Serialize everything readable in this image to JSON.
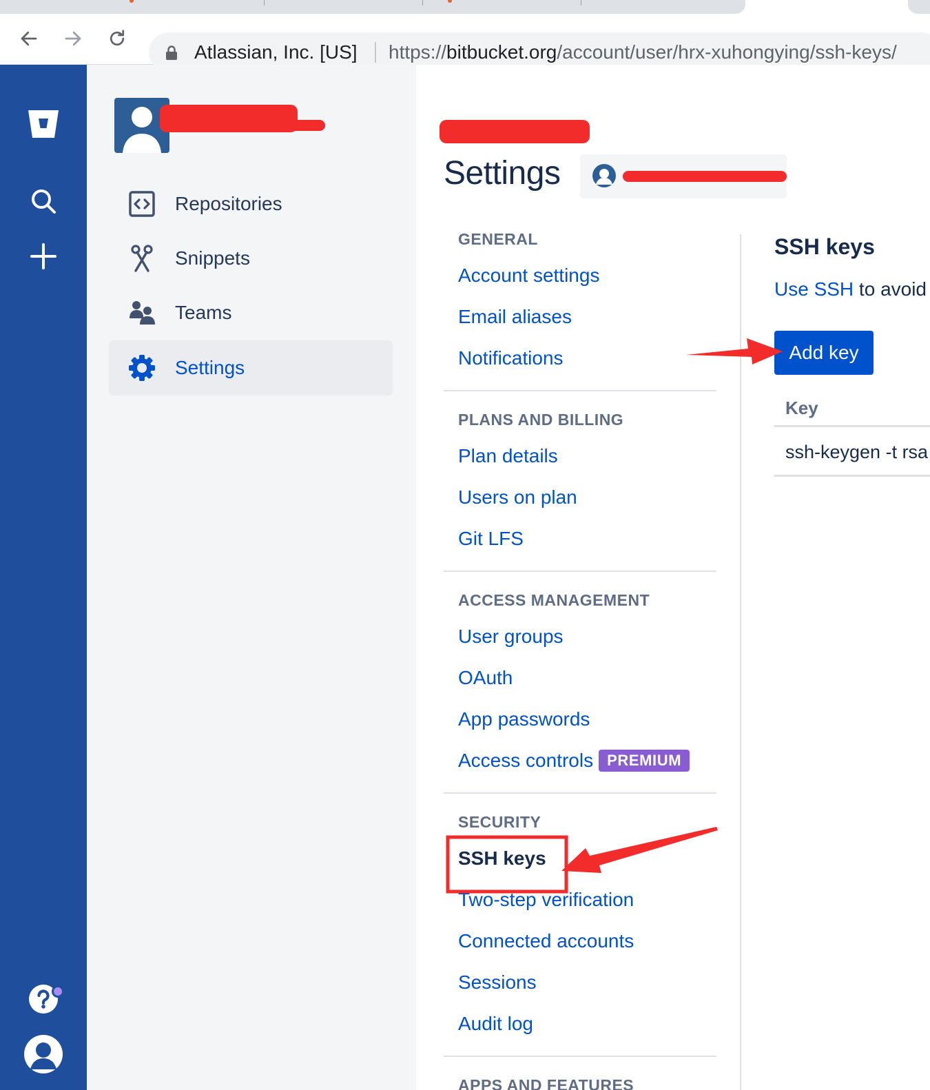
{
  "browser": {
    "cert_label": "Atlassian, Inc. [US]",
    "url_scheme": "https://",
    "url_host": "bitbucket.org",
    "url_path": "/account/user/hrx-xuhongying/ssh-keys/"
  },
  "sidebar": {
    "items": [
      {
        "label": "Repositories"
      },
      {
        "label": "Snippets"
      },
      {
        "label": "Teams"
      },
      {
        "label": "Settings"
      }
    ]
  },
  "main": {
    "title": "Settings",
    "settings_nav": {
      "general": {
        "heading": "GENERAL",
        "links": [
          "Account settings",
          "Email aliases",
          "Notifications"
        ]
      },
      "billing": {
        "heading": "PLANS AND BILLING",
        "links": [
          "Plan details",
          "Users on plan",
          "Git LFS"
        ]
      },
      "access": {
        "heading": "ACCESS MANAGEMENT",
        "links": [
          "User groups",
          "OAuth",
          "App passwords",
          "Access controls"
        ],
        "premium_badge": "PREMIUM"
      },
      "security": {
        "heading": "SECURITY",
        "links": [
          "SSH keys",
          "Two-step verification",
          "Connected accounts",
          "Sessions",
          "Audit log"
        ]
      },
      "apps": {
        "heading": "APPS AND FEATURES"
      }
    },
    "ssh": {
      "title": "SSH keys",
      "desc_link": "Use SSH",
      "desc_rest": " to avoid",
      "add_button": "Add key",
      "table_header": "Key",
      "table_row": "ssh-keygen -t rsa"
    }
  },
  "colors": {
    "global_nav": "#1e4e9c",
    "link": "#0052cc",
    "primary_button": "#0052cc",
    "premium_badge": "#8a5cd2",
    "annotation_red": "#f22b2b"
  }
}
